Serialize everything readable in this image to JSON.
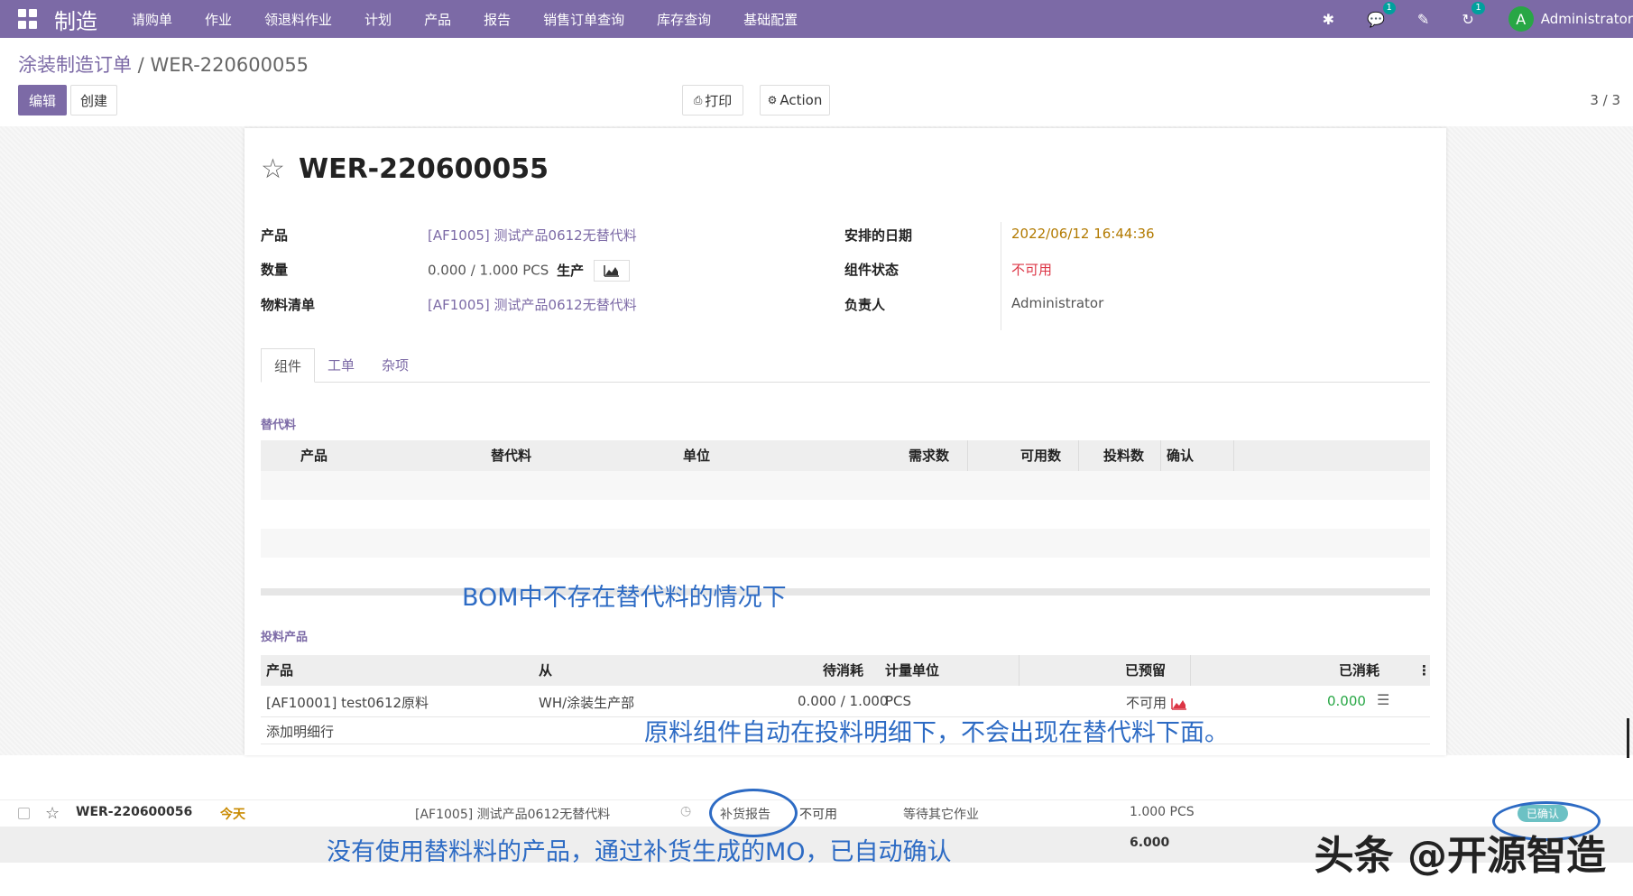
{
  "navbar": {
    "brand": "制造",
    "menu": [
      "请购单",
      "作业",
      "领退料作业",
      "计划",
      "产品",
      "报告",
      "销售订单查询",
      "库存查询",
      "基础配置"
    ],
    "messages_badge": "1",
    "activity_badge": "1",
    "avatar_letter": "A",
    "user": "Administrator"
  },
  "control": {
    "breadcrumb_parent": "涂装制造订单",
    "breadcrumb_sep": " / ",
    "breadcrumb_current": "WER-220600055",
    "edit_label": "编辑",
    "create_label": "创建",
    "print_label": "打印",
    "action_label": "Action",
    "pager": "3 / 3"
  },
  "record": {
    "title": "WER-220600055",
    "fields_left": [
      {
        "label": "产品",
        "value": "[AF1005] 测试产品0612无替代料"
      },
      {
        "label": "数量",
        "value": "0.000  /  1.000   PCS"
      },
      {
        "label": "物料清单",
        "value": "[AF1005] 测试产品0612无替代料"
      }
    ],
    "produce_label": "生产",
    "fields_right": [
      {
        "label": "安排的日期",
        "value": "2022/06/12 16:44:36"
      },
      {
        "label": "组件状态",
        "value": "不可用"
      },
      {
        "label": "负责人",
        "value": "Administrator"
      }
    ]
  },
  "tabs": [
    "组件",
    "工单",
    "杂项"
  ],
  "substitute_section": {
    "label": "替代料",
    "columns": [
      "产品",
      "替代料",
      "单位",
      "需求数",
      "可用数",
      "投料数",
      "确认"
    ]
  },
  "raw_section": {
    "label": "投料产品",
    "columns": [
      "产品",
      "从",
      "待消耗",
      "计量单位",
      "已预留",
      "已消耗"
    ],
    "rows": [
      {
        "product": "[AF10001] test0612原料",
        "from": "WH/涂装生产部",
        "to_consume": "0.000 / 1.000",
        "uom": "PCS",
        "reserved": "不可用",
        "consumed": "0.000"
      }
    ],
    "add_line": "添加明细行"
  },
  "annotations": {
    "a1": "BOM中不存在替代料的情况下",
    "a2": "原料组件自动在投料明细下，不会出现在替代料下面。",
    "a3": "没有使用替料料的产品，通过补货生成的MO，已自动确认"
  },
  "list": {
    "row": {
      "name": "WER-220600056",
      "date": "今天",
      "product": "[AF1005] 测试产品0612无替代料",
      "origin": "补货报告",
      "availability": "不可用",
      "status_text": "等待其它作业",
      "qty": "1.000  PCS",
      "state": "已确认"
    },
    "total": "6.000"
  },
  "watermark": "头条 @开源智造"
}
